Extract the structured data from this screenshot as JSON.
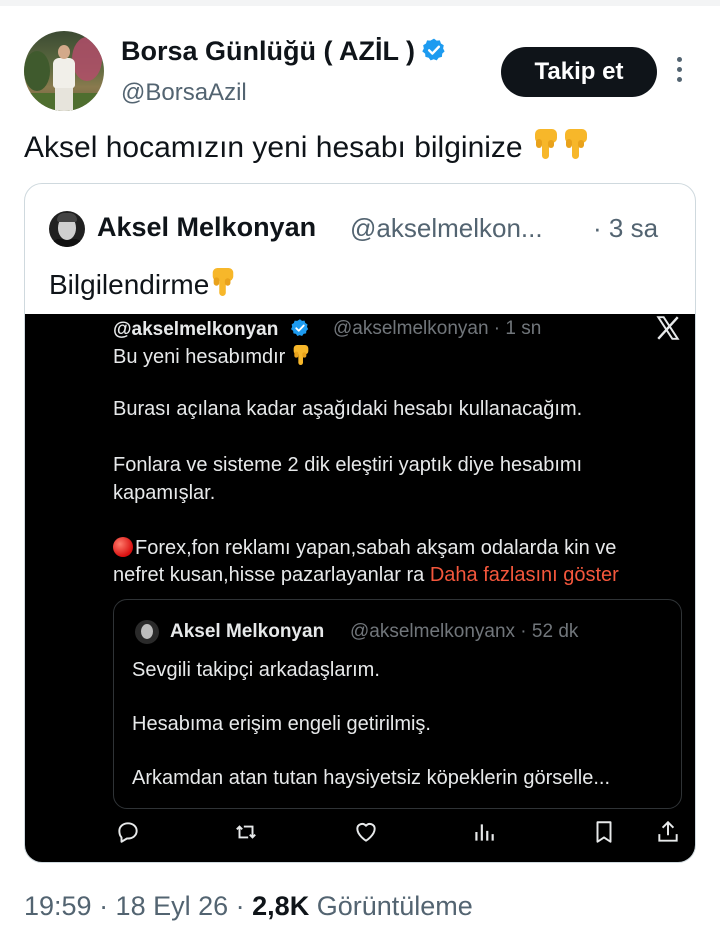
{
  "author": {
    "name": "Borsa Günlüğü ( AZİL )",
    "handle": "@BorsaAzil",
    "follow_label": "Takip et"
  },
  "tweet": {
    "text": "Aksel hocamızın yeni hesabı bilginize",
    "emoji": "pointing-down-hands"
  },
  "quote": {
    "name": "Aksel Melkonyan",
    "handle": "@akselmelkon...",
    "time": "· 3 sa",
    "text": "Bilgilendirme"
  },
  "screenshot": {
    "name": "@akselmelkonyan",
    "handle_time": "@akselmelkonyan · 1 sn",
    "lines": [
      "Bu yeni hesabımdır",
      "Burası açılana kadar aşağıdaki hesabı kullanacağım.",
      "Fonlara ve sisteme 2 dik eleştiri yaptık diye hesabımı",
      "kapamışlar.",
      "Forex,fon reklamı yapan,sabah akşam odalarda kin ve",
      "nefret kusan,hisse pazarlayanlar ra"
    ],
    "show_more": "Daha fazlasını göster",
    "inner": {
      "name": "Aksel Melkonyan",
      "handle_time": "@akselmelkonyanx · 52 dk",
      "lines": [
        "Sevgili takipçi arkadaşlarım.",
        " Hesabıma erişim engeli getirilmiş.",
        "Arkamdan atan tutan haysiyetsiz köpeklerin görselle..."
      ]
    }
  },
  "meta": {
    "time": "19:59 · 18 Eyl 26 ·",
    "views": "2,8K",
    "views_label": "Görüntüleme"
  },
  "colors": {
    "verified_blue": "#1d9bf0",
    "show_more": "#f4573c",
    "follow_bg": "#0f1419"
  }
}
